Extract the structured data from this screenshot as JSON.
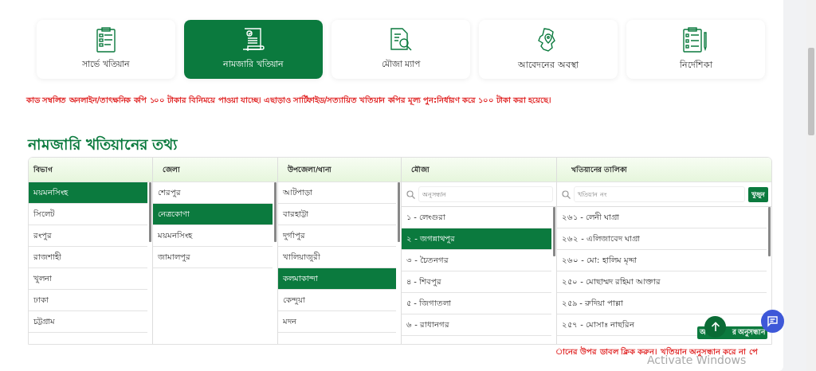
{
  "tabs": [
    {
      "label": "সার্ভে খতিয়ান",
      "selected": false
    },
    {
      "label": "নামজারি খতিয়ান",
      "selected": true
    },
    {
      "label": "মৌজা ম্যাপ",
      "selected": false
    },
    {
      "label": "আবেদনের অবস্থা",
      "selected": false
    },
    {
      "label": "নির্দেশিকা",
      "selected": false
    }
  ],
  "notice": "কাড সম্বলিত অনলাইন/তাৎক্ষনিক কপি ১০০ টাকার বিনিময়ে পাওয়া যাচ্ছে। এছাড়াও সার্টিফাইড/সত্যায়িত খতিয়ান কপির মূল্য পুন:নির্ধারণ করে ১০০ টাকা করা হয়েছে।",
  "heading": "নামজারি খতিয়ানের তথ্য",
  "columns": [
    {
      "title": "বিভাগ",
      "kind": "list",
      "items": [
        {
          "label": "ময়মনসিংহ",
          "selected": true
        },
        {
          "label": "সিলেট",
          "selected": false
        },
        {
          "label": "রংপুর",
          "selected": false
        },
        {
          "label": "রাজশাহী",
          "selected": false
        },
        {
          "label": "খুলনা",
          "selected": false
        },
        {
          "label": "ঢাকা",
          "selected": false
        },
        {
          "label": "চট্টগ্রাম",
          "selected": false
        }
      ]
    },
    {
      "title": "জেলা",
      "kind": "list",
      "items": [
        {
          "label": "শেরপুর",
          "selected": false
        },
        {
          "label": "নেত্রকোণা",
          "selected": true
        },
        {
          "label": "ময়মনসিংহ",
          "selected": false
        },
        {
          "label": "জামালপুর",
          "selected": false
        }
      ]
    },
    {
      "title": "উপজেলা/থানা",
      "kind": "list",
      "items": [
        {
          "label": "আটপাড়া",
          "selected": false
        },
        {
          "label": "বারহাট্টা",
          "selected": false
        },
        {
          "label": "দুর্গাপুর",
          "selected": false
        },
        {
          "label": "খালিয়াজুরী",
          "selected": false
        },
        {
          "label": "কলমাকান্দা",
          "selected": true
        },
        {
          "label": "কেন্দুয়া",
          "selected": false
        },
        {
          "label": "মদন",
          "selected": false
        }
      ]
    },
    {
      "title": "মৌজা",
      "kind": "search",
      "placeholder": "অনুসন্ধান",
      "items": [
        {
          "label": "১ - লেংগুরা",
          "selected": false
        },
        {
          "label": "২ - জগন্নাথপুর",
          "selected": true
        },
        {
          "label": "৩ - চৈতনগর",
          "selected": false
        },
        {
          "label": "৪ - শিবপুর",
          "selected": false
        },
        {
          "label": "৫ - জিগাতলা",
          "selected": false
        },
        {
          "label": "৬ - রাধানগর",
          "selected": false
        }
      ]
    },
    {
      "title": "খতিয়ানের তালিকা",
      "kind": "search",
      "placeholder": "খতিয়ান নং",
      "button": "খুজুন",
      "items": [
        {
          "label": "২৬১ - লেনী ঘাগ্রা",
          "selected": false
        },
        {
          "label": "২৬২ - এলিজাবেদ ঘাগ্রা",
          "selected": false
        },
        {
          "label": "২৬০ - মো: হালিম মৃদ্দা",
          "selected": false
        },
        {
          "label": "২৫০ - মোছাম্মদ রহিমা আক্তার",
          "selected": false
        },
        {
          "label": "২৫৯ - রুদিয়া পাল্লা",
          "selected": false
        },
        {
          "label": "২৫৭ - মোসাঃ নাছরিন",
          "selected": false
        }
      ]
    }
  ],
  "footnote": "ানের উপর ডাবল ক্লিক করুন। খতিয়ান অনুসন্ধান করে না পে",
  "floating_button": {
    "label_parts": [
      "অ",
      "র অনুসন্ধান"
    ]
  },
  "os_notice": "Activate Windows"
}
